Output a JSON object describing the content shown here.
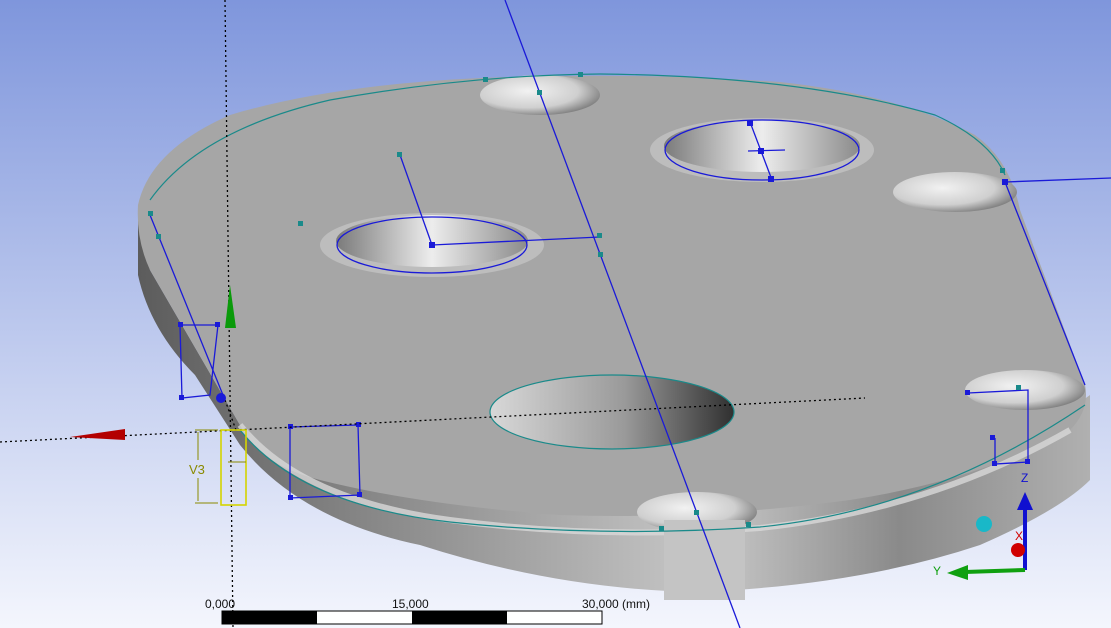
{
  "viewport": {
    "background_top": "#7f96dc",
    "background_bottom": "#f4f6fd"
  },
  "model": {
    "face_color": "#a6a6a6",
    "side_color": "#8c8c8c",
    "sketch_color": "#1a1ad8",
    "edge_color": "#1a8a8a",
    "selection_color": "#e8e800"
  },
  "dimension": {
    "label": "V3"
  },
  "triad": {
    "z_label": "Z",
    "x_label": "X",
    "y_label": "Y",
    "x_color": "#d00000",
    "y_color": "#10a010",
    "z_color": "#1010d0"
  },
  "scale_bar": {
    "labels": [
      "0,000",
      "15,000",
      "30,000 (mm)"
    ]
  }
}
